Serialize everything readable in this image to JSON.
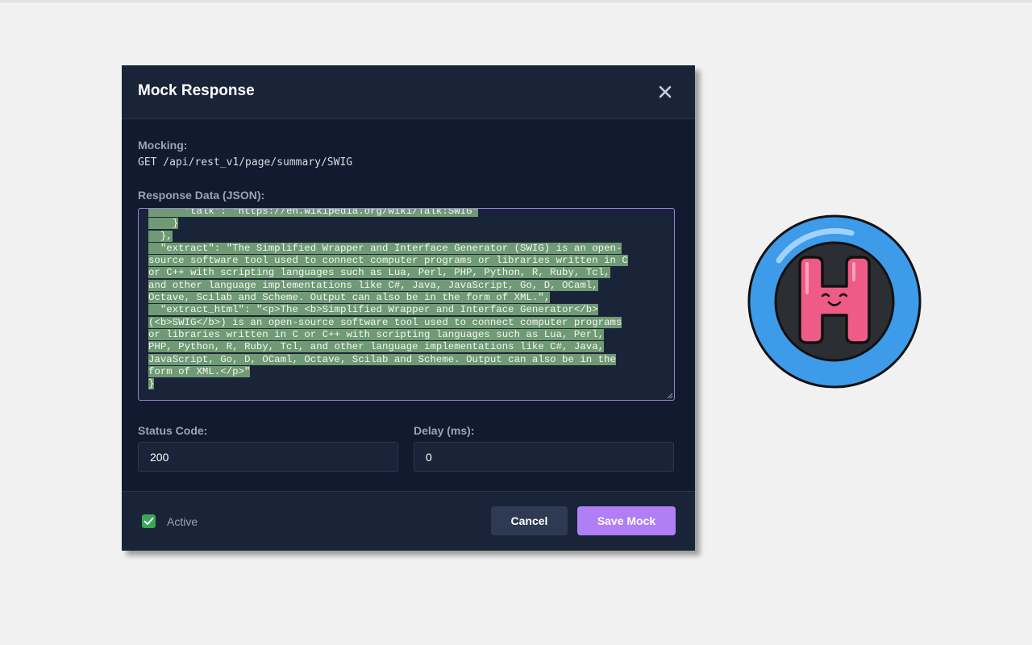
{
  "modal": {
    "title": "Mock Response",
    "mocking_label": "Mocking:",
    "endpoint": "GET /api/rest_v1/page/summary/SWIG",
    "response_label": "Response Data (JSON):",
    "response_lines": [
      "      \"talk\": \"https://en.wikipedia.org/wiki/Talk:SWIG\"",
      "    }",
      "  },",
      "  \"extract\": \"The Simplified Wrapper and Interface Generator (SWIG) is an open-",
      "source software tool used to connect computer programs or libraries written in C",
      "or C++ with scripting languages such as Lua, Perl, PHP, Python, R, Ruby, Tcl,",
      "and other language implementations like C#, Java, JavaScript, Go, D, OCaml,",
      "Octave, Scilab and Scheme. Output can also be in the form of XML.\",",
      "  \"extract_html\": \"<p>The <b>Simplified Wrapper and Interface Generator</b>",
      "(<b>SWIG</b>) is an open-source software tool used to connect computer programs",
      "or libraries written in C or C++ with scripting languages such as Lua, Perl,",
      "PHP, Python, R, Ruby, Tcl, and other language implementations like C#, Java,",
      "JavaScript, Go, D, OCaml, Octave, Scilab and Scheme. Output can also be in the",
      "form of XML.</p>\"",
      "}"
    ],
    "status_label": "Status Code:",
    "status_value": "200",
    "delay_label": "Delay (ms):",
    "delay_value": "0",
    "active_label": "Active",
    "active_checked": true,
    "cancel_label": "Cancel",
    "save_label": "Save Mock"
  },
  "colors": {
    "modal_bg": "#111a2f",
    "panel_bg": "#1a2438",
    "accent": "#b07ef5",
    "selection": "#6f9a73",
    "checkbox": "#3aa657",
    "logo_ring": "#3d9be9",
    "logo_letter": "#ef5b87"
  },
  "icons": {
    "close": "close-icon",
    "check": "checkmark-icon",
    "logo": "h-logo-icon"
  }
}
